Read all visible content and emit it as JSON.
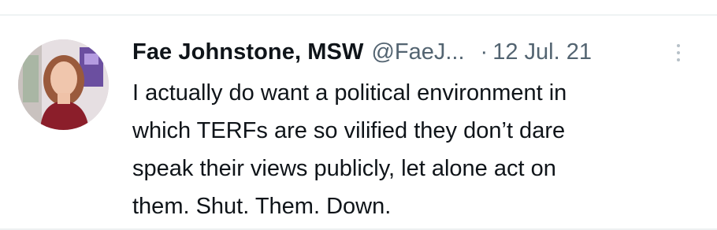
{
  "tweet": {
    "display_name": "Fae Johnstone, MSW",
    "handle": "@FaeJ...",
    "separator": "·",
    "date": "12 Jul. 21",
    "text_lines": [
      "I actually do want a political environment in",
      "which TERFs are so vilified they don’t dare",
      "speak their views publicly, let alone act on",
      "them. Shut. Them. Down."
    ]
  },
  "icons": {
    "more": "more-options-icon",
    "avatar": "avatar"
  },
  "colors": {
    "name": "#0f1419",
    "secondary": "#536471",
    "background": "#ffffff"
  }
}
